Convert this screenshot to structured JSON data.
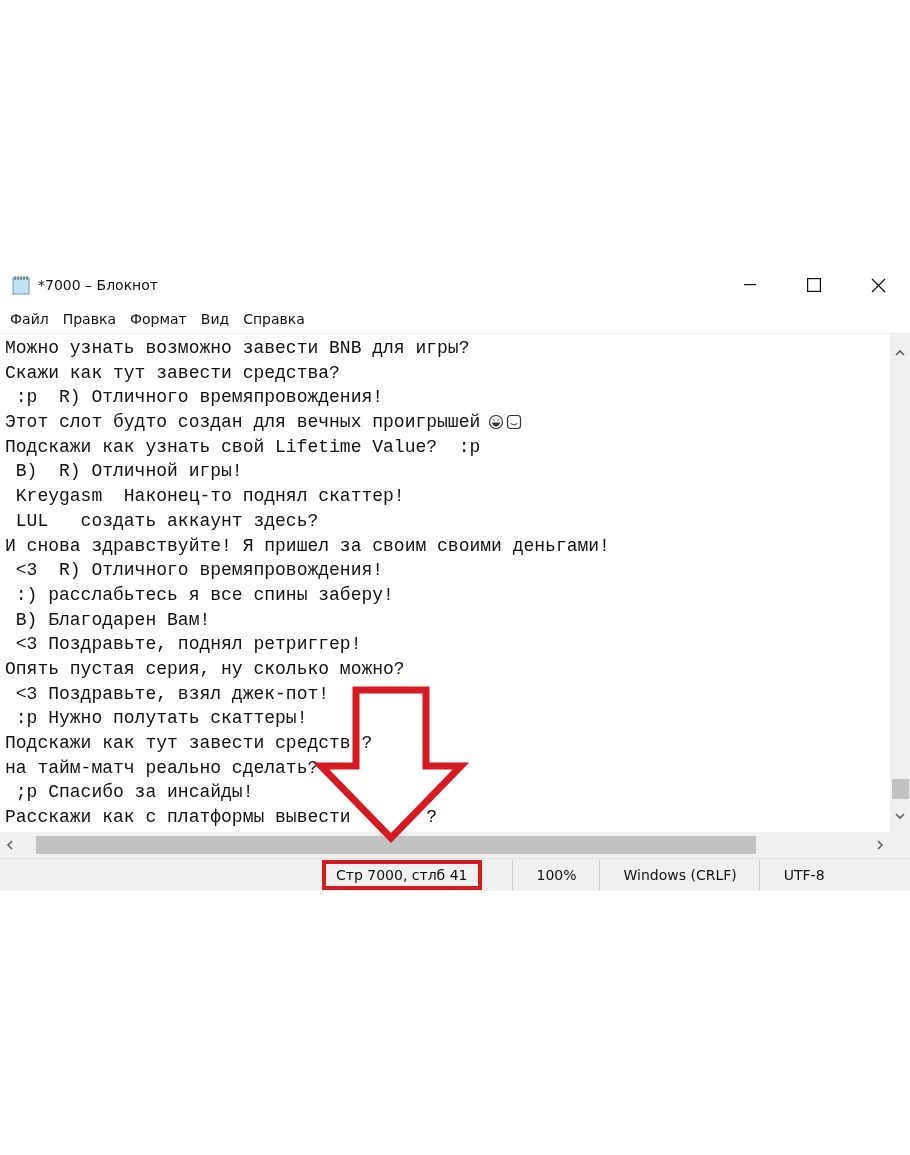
{
  "window": {
    "title": "*7000 – Блокнот"
  },
  "menu": [
    "Файл",
    "Правка",
    "Формат",
    "Вид",
    "Справка"
  ],
  "lines": [
    {
      "text": "Можно узнать возможно завести BNB для игры?"
    },
    {
      "text": "Скажи как тут завести средства?"
    },
    {
      "text": " :p  R) Отличного времяпровождения!"
    },
    {
      "text": "Этот слот будто создан для вечных проигрышей",
      "emojis": [
        {
          "kind": "grin"
        },
        {
          "kind": "smile"
        }
      ]
    },
    {
      "text": "Подскажи как узнать свой Lifetime Value?  :p"
    },
    {
      "text": " B)  R) Отличной игры!"
    },
    {
      "text": " Kreygasm  Наконец-то поднял скаттер!"
    },
    {
      "text": " LUL   создать аккаунт здесь?"
    },
    {
      "text": "И снова здравствуйте! Я пришел за своим своими деньгами!"
    },
    {
      "text": " <3  R) Отличного времяпровождения!"
    },
    {
      "text": " :) расслабьтесь я все спины заберу!"
    },
    {
      "text": " B) Благодарен Вам!"
    },
    {
      "text": " <3 Поздравьте, поднял ретриггер!"
    },
    {
      "text": "Опять пустая серия, ну сколько можно?"
    },
    {
      "text": " <3 Поздравьте, взял джек-пот!"
    },
    {
      "text": " :p Нужно полутать скаттеры!"
    },
    {
      "text": "Подскажи как тут завести средств",
      "tail": "?"
    },
    {
      "text": "на тайм-матч реально сделать?"
    },
    {
      "text": " ;p Спасибо за инсайды!"
    },
    {
      "text": "Расскажи как с платформы вывести",
      "tail": "?"
    }
  ],
  "status_bar": [
    {
      "text": "Стр 7000, стлб 41",
      "highlighted": true
    },
    {
      "text": "100%",
      "highlighted": false
    },
    {
      "text": "Windows (CRLF)",
      "highlighted": false
    },
    {
      "text": "UTF-8",
      "highlighted": false
    }
  ],
  "annotation": {
    "kind": "arrow"
  }
}
